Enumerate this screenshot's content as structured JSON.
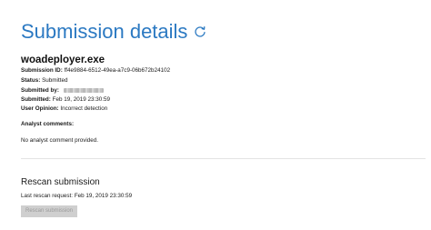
{
  "header": {
    "title": "Submission details",
    "refresh_icon": "refresh-icon"
  },
  "submission": {
    "file_name": "woadeployer.exe",
    "id_label": "Submission ID:",
    "id_value": "ff4e9884-6512-49ea-a7c9-06b672b24102",
    "status_label": "Status:",
    "status_value": "Submitted",
    "submitted_by_label": "Submitted by:",
    "submitted_label": "Submitted:",
    "submitted_value": "Feb 19, 2019 23:30:59",
    "opinion_label": "User Opinion:",
    "opinion_value": "Incorrect detection"
  },
  "analyst": {
    "label": "Analyst comments:",
    "text": "No analyst comment provided."
  },
  "rescan": {
    "heading": "Rescan submission",
    "last_request_label": "Last rescan request:",
    "last_request_value": "Feb 19, 2019 23:30:59",
    "button_label": "Rescan submission"
  },
  "colors": {
    "title": "#2b79c2",
    "button_disabled_bg": "#cfcfcf",
    "button_disabled_text": "#9a9a9a",
    "divider": "#e3e3e3"
  }
}
